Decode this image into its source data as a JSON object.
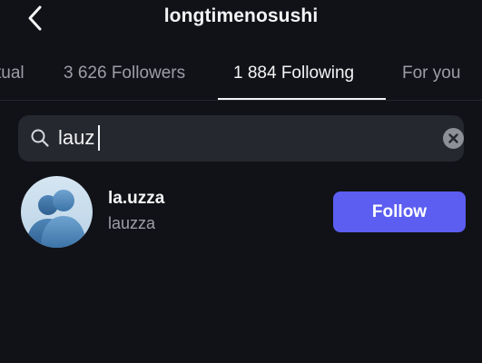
{
  "header": {
    "title": "longtimenosushi"
  },
  "tabs": [
    {
      "label": "tual",
      "active": false
    },
    {
      "label": "3 626 Followers",
      "active": false
    },
    {
      "label": "1 884 Following",
      "active": true
    },
    {
      "label": "For you",
      "active": false
    }
  ],
  "search": {
    "value": "lauz"
  },
  "results": [
    {
      "username": "la.uzza",
      "handle": "lauzza",
      "button_label": "Follow"
    }
  ],
  "colors": {
    "background": "#111217",
    "search_background": "#26282f",
    "accent": "#5b5ef0",
    "primary_text": "#f4f4f6",
    "secondary_text": "#9c9ea6"
  },
  "icons": {
    "back": "chevron-left-icon",
    "search": "search-icon",
    "clear": "clear-icon",
    "avatar": "default-avatar-icon"
  }
}
